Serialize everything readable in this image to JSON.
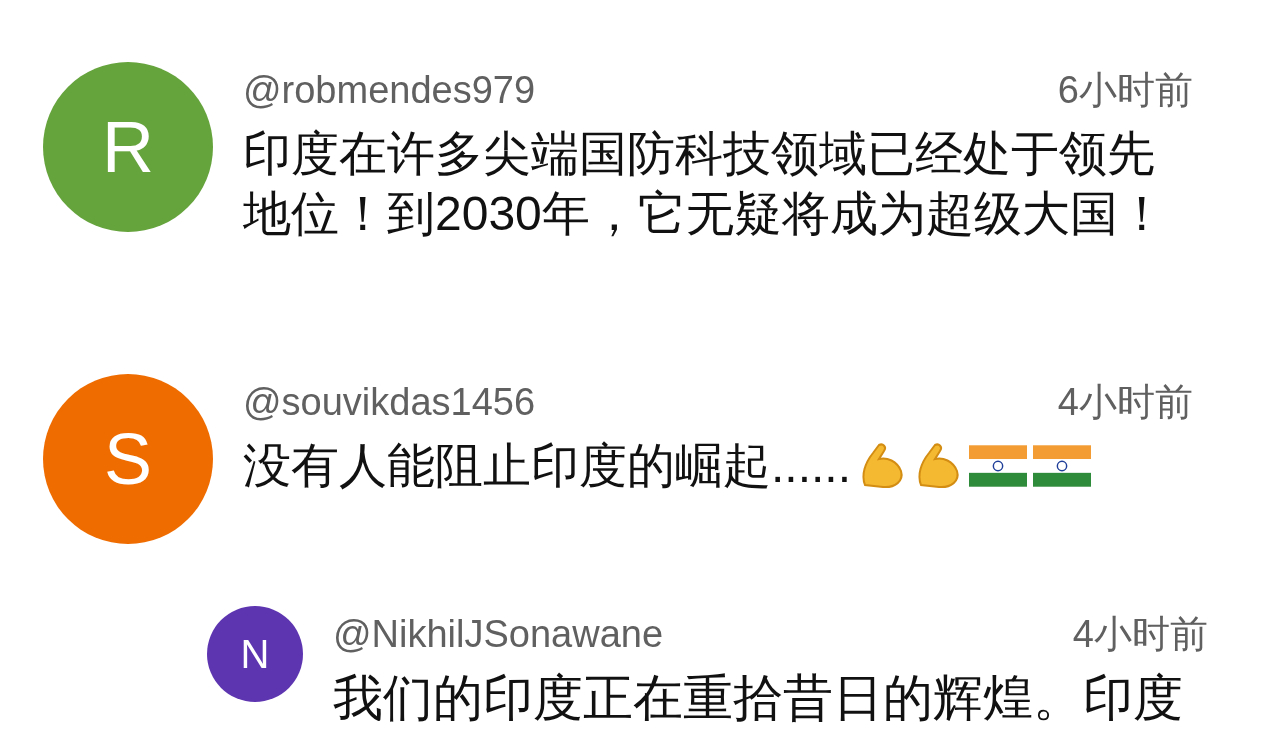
{
  "comments": [
    {
      "avatar_letter": "R",
      "color": "#65a33c",
      "user": "@robmendes979",
      "time": "6小时前",
      "text": "印度在许多尖端国防科技领域已经处于领先地位！到2030年，它无疑将成为超级大国！"
    },
    {
      "avatar_letter": "S",
      "color": "#ef6c00",
      "user": "@souvikdas1456",
      "time": "4小时前",
      "text": "没有人能阻止印度的崛起......",
      "emojis": [
        {
          "kind": "arm"
        },
        {
          "kind": "arm"
        },
        {
          "kind": "flag"
        },
        {
          "kind": "flag"
        }
      ],
      "replies": [
        {
          "avatar_letter": "N",
          "color": "#5e35b1",
          "user": "@NikhilJSonawane",
          "time": "4小时前",
          "text": "我们的印度正在重拾昔日的辉煌。印度"
        }
      ]
    }
  ]
}
